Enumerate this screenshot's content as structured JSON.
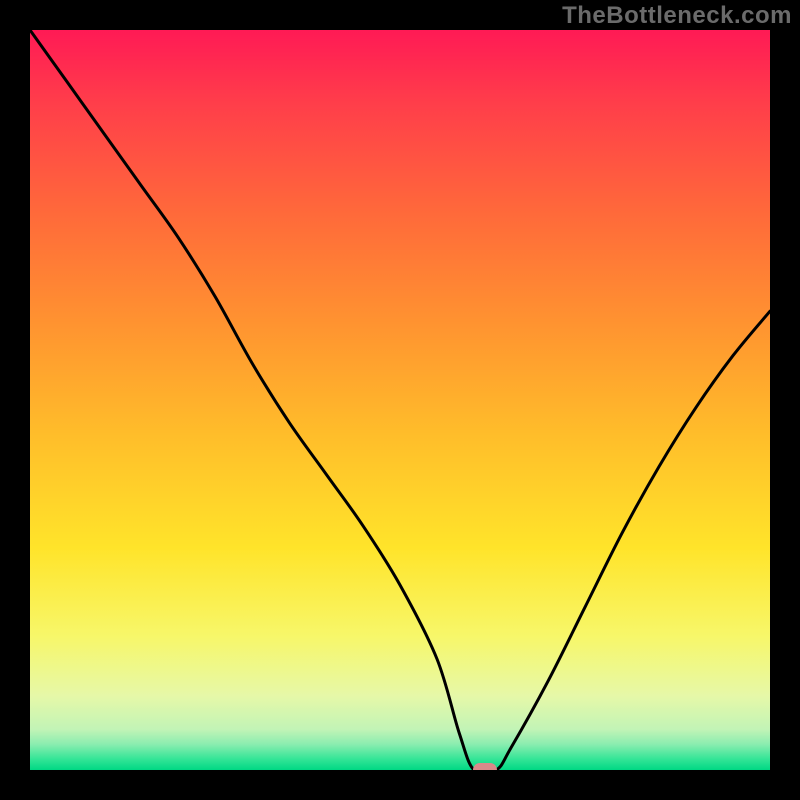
{
  "watermark": "TheBottleneck.com",
  "chart_data": {
    "type": "line",
    "title": "",
    "xlabel": "",
    "ylabel": "",
    "xlim": [
      0,
      100
    ],
    "ylim": [
      0,
      100
    ],
    "grid": false,
    "series": [
      {
        "name": "bottleneck-curve",
        "color": "#000000",
        "x": [
          0,
          5,
          10,
          15,
          20,
          25,
          30,
          35,
          40,
          45,
          50,
          55,
          58,
          60,
          63,
          65,
          70,
          75,
          80,
          85,
          90,
          95,
          100
        ],
        "y": [
          100,
          93,
          86,
          79,
          72,
          64,
          55,
          47,
          40,
          33,
          25,
          15,
          5,
          0,
          0,
          3,
          12,
          22,
          32,
          41,
          49,
          56,
          62
        ]
      }
    ],
    "marker": {
      "x": 61.5,
      "y": 0,
      "color": "#d98a8a"
    },
    "gradient_stops": [
      {
        "offset": 0.0,
        "color": "#ff1a55"
      },
      {
        "offset": 0.1,
        "color": "#ff3e4a"
      },
      {
        "offset": 0.25,
        "color": "#ff6a3a"
      },
      {
        "offset": 0.4,
        "color": "#ff9430"
      },
      {
        "offset": 0.55,
        "color": "#ffbe2a"
      },
      {
        "offset": 0.7,
        "color": "#ffe42a"
      },
      {
        "offset": 0.82,
        "color": "#f7f76a"
      },
      {
        "offset": 0.9,
        "color": "#e6f8a8"
      },
      {
        "offset": 0.945,
        "color": "#c2f4b6"
      },
      {
        "offset": 0.965,
        "color": "#8bedb0"
      },
      {
        "offset": 0.985,
        "color": "#35e597"
      },
      {
        "offset": 1.0,
        "color": "#00d884"
      }
    ]
  }
}
